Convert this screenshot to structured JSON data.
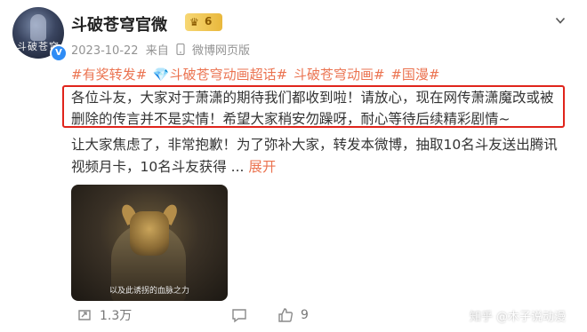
{
  "account": {
    "name": "斗破苍穹官微",
    "vip_level": "6",
    "avatar_text": "斗破苍穹",
    "timestamp": "2023-10-22",
    "source": "来自",
    "source_icon": "mobile-icon",
    "client": "微博网页版"
  },
  "post": {
    "tags": [
      "#有奖转发#",
      "💎斗破苍穹动画超话#",
      "斗破苍穹动画#",
      "#国漫#"
    ],
    "lines": [
      "各位斗友，大家对于萧潇的期待我们都收到啦！请放心，现在网传萧潇魔改或被",
      "删除的传言并不是实情！希望大家稍安勿躁呀，耐心等待后续精彩剧情~",
      "让大家焦虑了，非常抱歉！为了弥补大家，转发本微博，抽取10名斗友送出腾讯",
      "视频月卡，10名斗友获得 ..."
    ],
    "more_label": "展开",
    "highlight_color": "#e0241b",
    "tag_color": "#eb7350"
  },
  "video": {
    "subtitle": "以及此诱拐的血脉之力"
  },
  "actions": {
    "repost_count": "1.3万",
    "comment_count": "",
    "like_count": "9"
  },
  "watermark": {
    "part1": "知乎",
    "part2": "@木子说动漫"
  }
}
